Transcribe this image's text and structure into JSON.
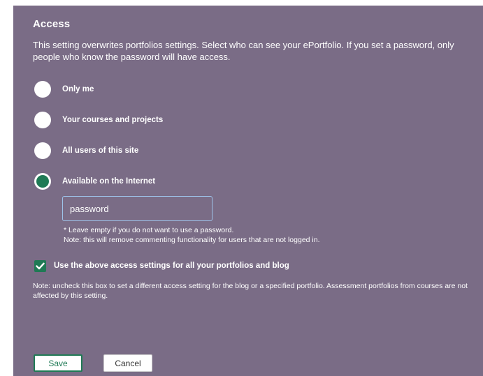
{
  "access": {
    "title": "Access",
    "description": "This setting overwrites portfolios settings. Select who can see your ePortfolio. If you set a password, only people who know the password will have access.",
    "options": [
      {
        "label": "Only me",
        "selected": false
      },
      {
        "label": "Your courses and projects",
        "selected": false
      },
      {
        "label": "All users of this site",
        "selected": false
      },
      {
        "label": "Available on the Internet",
        "selected": true
      }
    ],
    "password": {
      "value": "password",
      "hint_line1": "* Leave empty if you do not want to use a password.",
      "hint_line2": "Note: this will remove commenting functionality for users that are not logged in."
    },
    "apply_all": {
      "label": "Use the above access settings for all your portfolios and blog",
      "checked": true
    },
    "note": "Note: uncheck this box to set a different access setting for the blog or a specified portfolio. Assessment portfolios from courses are not affected by this setting."
  },
  "buttons": {
    "save": "Save",
    "cancel": "Cancel"
  },
  "colors": {
    "panel_bg": "#7a6c86",
    "accent": "#1f7a55",
    "input_border": "#9ec3ea"
  }
}
